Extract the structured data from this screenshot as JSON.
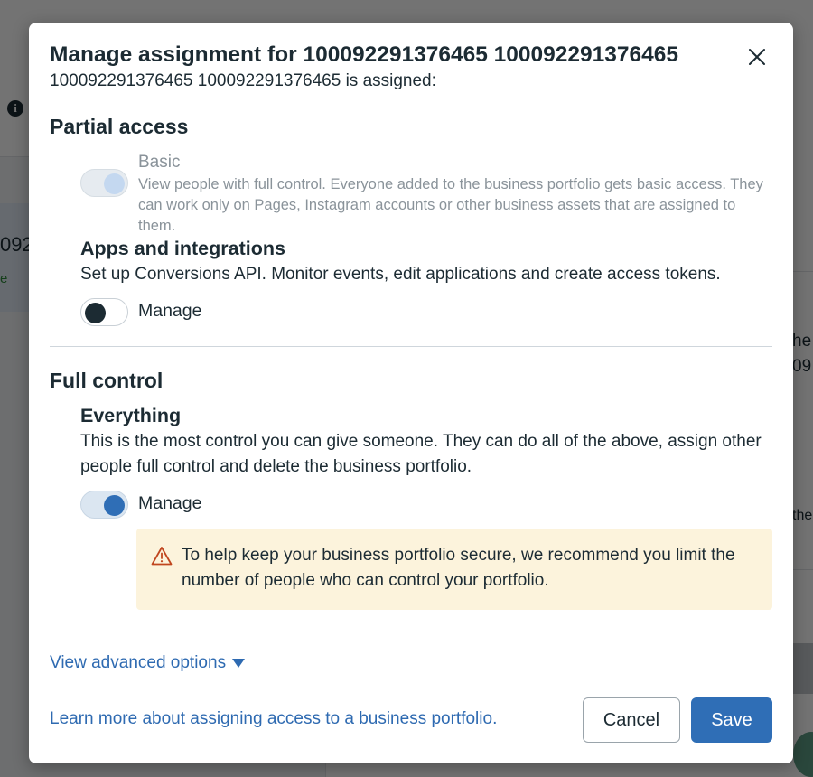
{
  "background": {
    "left_id_fragment": "092",
    "left_status_fragment": "e",
    "right_text_1": "he",
    "right_text_2": "09",
    "right_text_3": "the"
  },
  "dialog": {
    "title": "Manage assignment for 100092291376465 100092291376465",
    "subtitle": "100092291376465 100092291376465 is assigned:",
    "close_icon": "close-icon"
  },
  "partial_access": {
    "heading": "Partial access",
    "basic": {
      "label": "Basic",
      "description": "View people with full control. Everyone added to the business portfolio gets basic access. They can work only on Pages, Instagram accounts or other business assets that are assigned to them.",
      "toggle_state": "on-disabled"
    },
    "apps": {
      "title": "Apps and integrations",
      "description": "Set up Conversions API. Monitor events, edit applications and create access tokens.",
      "toggle_label": "Manage",
      "toggle_state": "off"
    }
  },
  "full_control": {
    "heading": "Full control",
    "everything": {
      "title": "Everything",
      "description": "This is the most control you can give someone. They can do all of the above, assign other people full control and delete the business portfolio.",
      "toggle_label": "Manage",
      "toggle_state": "on"
    },
    "warning": {
      "icon": "warning-triangle-icon",
      "text": "To help keep your business portfolio secure, we recommend you limit the number of people who can control your portfolio."
    }
  },
  "footer": {
    "advanced_options": "View advanced options",
    "learn_more": "Learn more about assigning access to a business portfolio.",
    "cancel_label": "Cancel",
    "save_label": "Save"
  },
  "colors": {
    "accent": "#2f6eb6",
    "link": "#2e6ab1",
    "warning_bg": "#fcf3dc",
    "warning_icon": "#c0461f",
    "text": "#1c2b33"
  }
}
